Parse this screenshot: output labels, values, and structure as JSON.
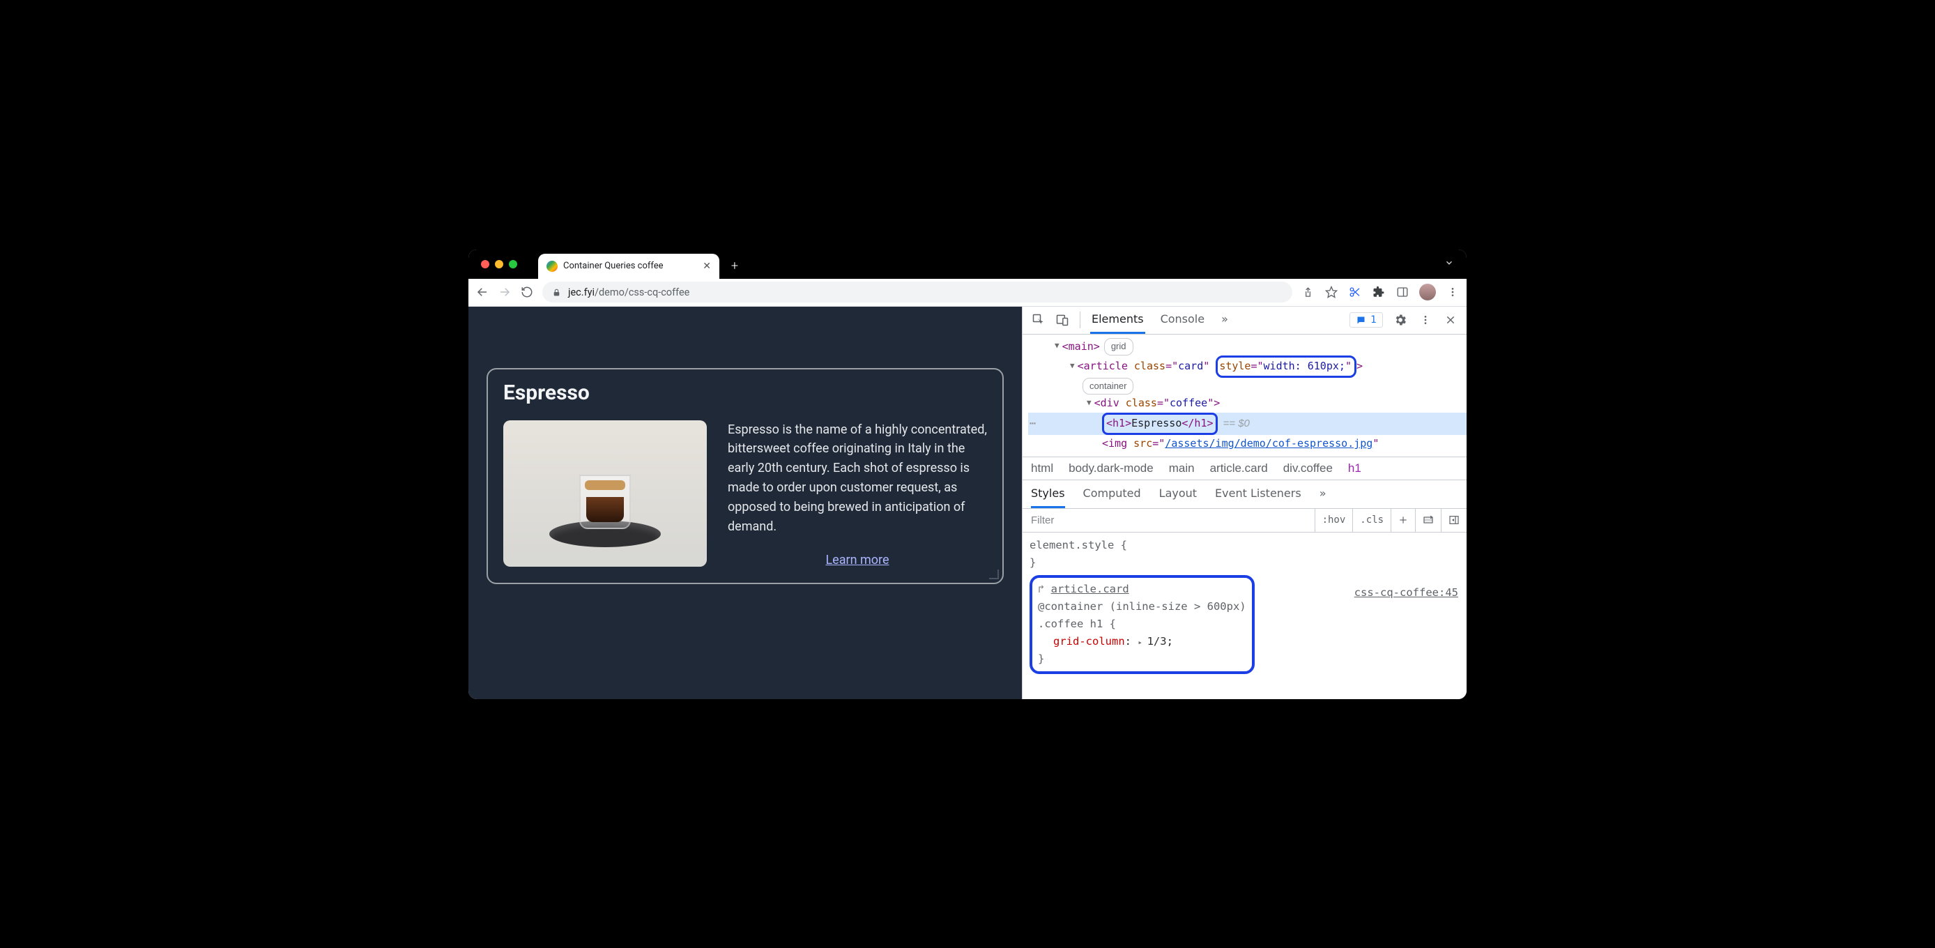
{
  "window": {
    "tab_title": "Container Queries coffee",
    "url_host": "jec.fyi",
    "url_path": "/demo/css-cq-coffee"
  },
  "page": {
    "card_title": "Espresso",
    "card_body": "Espresso is the name of a highly concentrated, bittersweet coffee originating in Italy in the early 20th century. Each shot of espresso is made to order upon customer request, as opposed to being brewed in anticipation of demand.",
    "learn_more": "Learn more"
  },
  "devtools": {
    "tabs": {
      "elements": "Elements",
      "console": "Console"
    },
    "issue_count": "1",
    "dom": {
      "main_tag": "main",
      "main_badge": "grid",
      "article_open": "article",
      "article_class": "card",
      "article_style": "width: 610px;",
      "article_badge": "container",
      "div_tag": "div",
      "div_class": "coffee",
      "h1_open": "<h1>",
      "h1_text": "Espresso",
      "h1_close": "</h1>",
      "eq0": "== $0",
      "img_tag": "img",
      "img_src": "/assets/img/demo/cof-espresso.jpg"
    },
    "crumbs": {
      "html": "html",
      "body": "body.dark-mode",
      "main": "main",
      "article": "article.card",
      "div": "div.coffee",
      "h1": "h1"
    },
    "styles_tabs": {
      "styles": "Styles",
      "computed": "Computed",
      "layout": "Layout",
      "event": "Event Listeners"
    },
    "styles_controls": {
      "filter": "Filter",
      "hov": ":hov",
      "cls": ".cls"
    },
    "styles": {
      "element_style": "element.style {",
      "element_style_close": "}",
      "container_link": "article.card",
      "container_query": "@container (inline-size > 600px)",
      "selector": ".coffee h1 {",
      "prop": "grid-column",
      "val": "1/3",
      "close": "}",
      "source": "css-cq-coffee:45"
    }
  }
}
